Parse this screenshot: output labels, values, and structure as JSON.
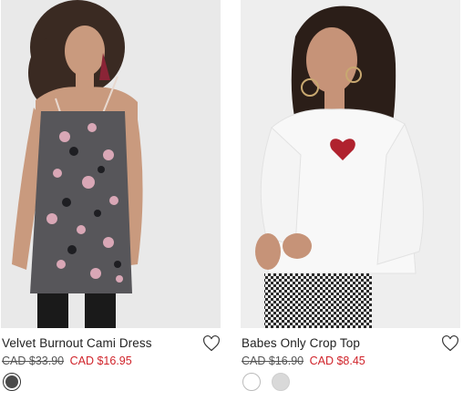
{
  "products": [
    {
      "name": "Velvet Burnout Cami Dress",
      "original_price": "CAD $33.90",
      "sale_price": "CAD $16.95",
      "favorite_icon": "heart-outline-icon",
      "swatches": [
        {
          "color": "#4a4a4a",
          "selected": true
        }
      ]
    },
    {
      "name": "Babes Only Crop Top",
      "original_price": "CAD $16.90",
      "sale_price": "CAD $8.45",
      "favorite_icon": "heart-outline-icon",
      "swatches": [
        {
          "color": "#ffffff",
          "selected": false
        },
        {
          "color": "#d9d9d9",
          "selected": false
        }
      ]
    }
  ],
  "colors": {
    "sale_price": "#d0232a",
    "original_price": "#555555",
    "product_name": "#222222"
  }
}
